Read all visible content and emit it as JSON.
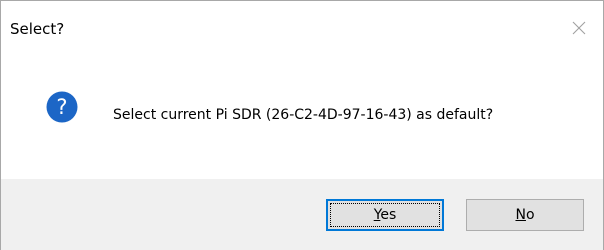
{
  "window": {
    "title": "Select?"
  },
  "icons": {
    "close": "close-icon",
    "question": "question-icon",
    "accent_color": "#1c66c6"
  },
  "message": {
    "text": "Select current Pi SDR (26-C2-4D-97-16-43) as default?"
  },
  "buttons": {
    "yes": {
      "mnemonic": "Y",
      "rest": "es"
    },
    "no": {
      "mnemonic": "N",
      "rest": "o"
    }
  }
}
